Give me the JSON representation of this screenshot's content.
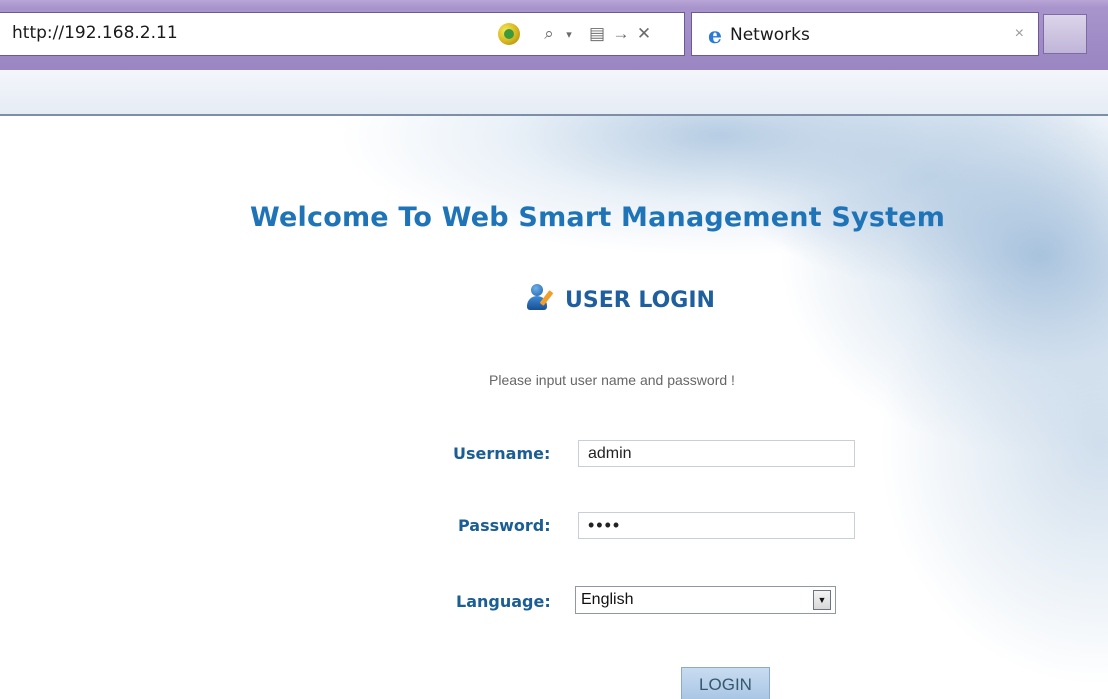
{
  "browser": {
    "address": "http://192.168.2.11",
    "tab_title": "Networks",
    "tab_close": "×",
    "icons": {
      "compat": "compatibility-icon",
      "search": "search-icon",
      "dropdown": "dropdown-arrow-icon",
      "compat_view": "compatibility-view-icon",
      "go": "go-arrow-icon",
      "stop": "stop-icon",
      "tab": "internet-explorer-icon"
    },
    "glyphs": {
      "search": "⌕",
      "dropdown": "▾",
      "compat_view": "▤",
      "go": "→",
      "stop": "✕",
      "tab_logo": "e"
    }
  },
  "page": {
    "welcome": "Welcome To Web Smart Management System",
    "login_title": "USER LOGIN",
    "prompt": "Please input user name and password !",
    "username_label": "Username:",
    "username_value": "admin",
    "password_label": "Password:",
    "password_value": "••••",
    "language_label": "Language:",
    "language_value": "English",
    "language_arrow": "▼",
    "login_button": "LOGIN"
  },
  "colors": {
    "heading": "#1f74b8",
    "label": "#1b5e94",
    "chrome": "#9f8cc6"
  }
}
